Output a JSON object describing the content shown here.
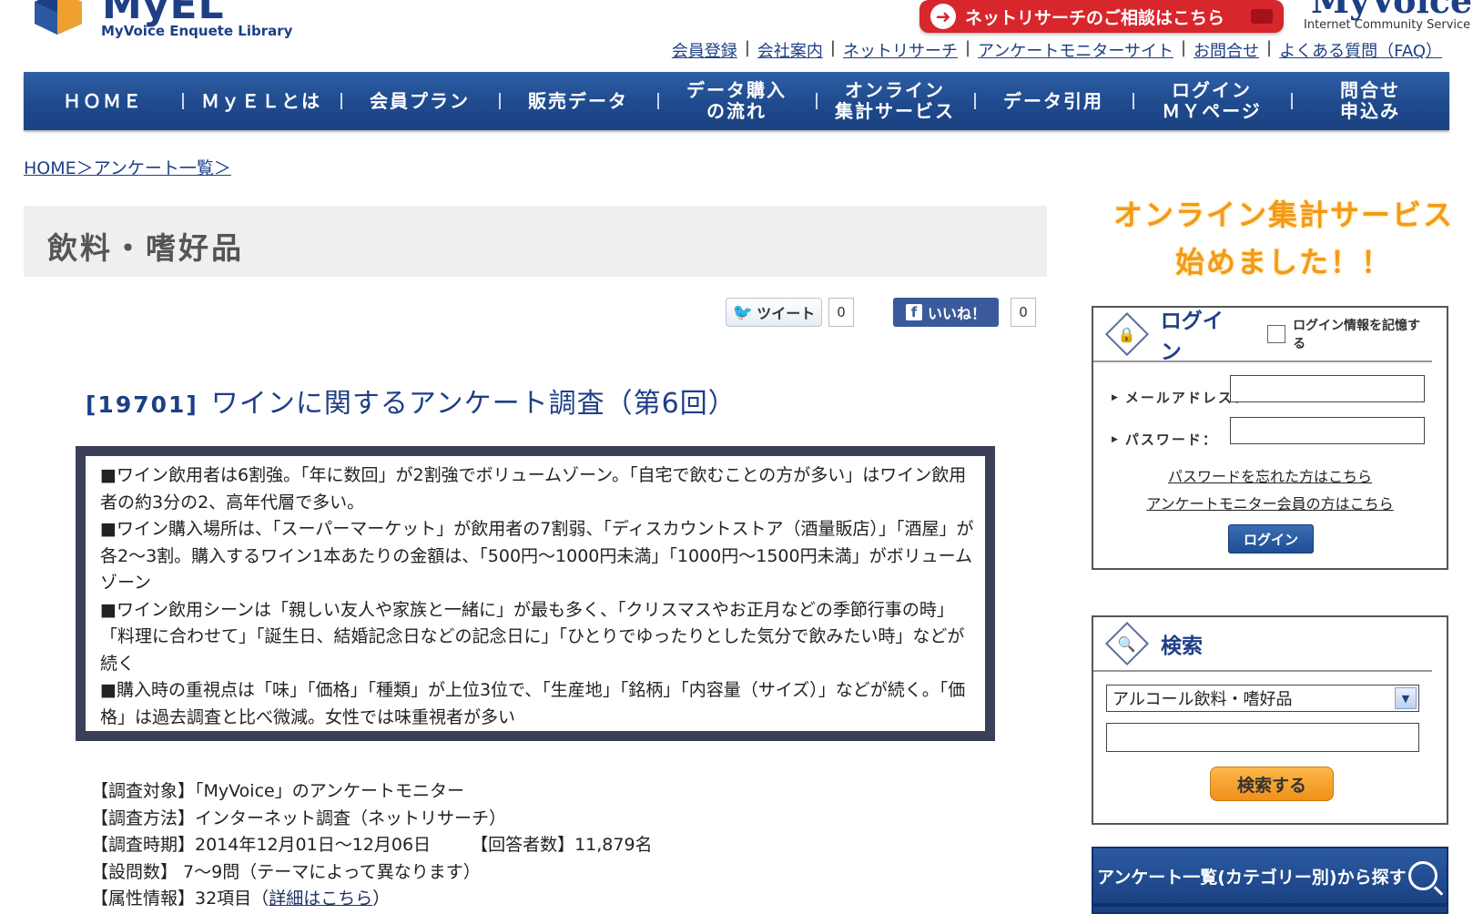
{
  "header": {
    "logo_text": "MyEL",
    "logo_sub": "MyVoice Enquete Library",
    "consult_label": "ネットリサーチのご相談はこちら",
    "brand_name": "MyVoice",
    "brand_sub": "Internet Community Service",
    "top_links": [
      "会員登録",
      "会社案内",
      "ネットリサーチ",
      "アンケートモニターサイト",
      "お問合せ",
      "よくある質問（FAQ）"
    ]
  },
  "nav": {
    "items": [
      "ＨＯＭＥ",
      "ＭｙＥＬとは",
      "会員プラン",
      "販売データ",
      "データ購入\nの流れ",
      "オンライン\n集計サービス",
      "データ引用",
      "ログイン\nＭＹページ",
      "問合せ\n申込み"
    ]
  },
  "breadcrumb": "HOME＞アンケート一覧＞",
  "category_title": "飲料・嗜好品",
  "social": {
    "tweet_label": "ツイート",
    "tweet_count": "0",
    "like_label": "いいね！",
    "like_count": "0"
  },
  "survey": {
    "number": "[19701]",
    "title": "ワインに関するアンケート調査（第6回）",
    "summary": [
      "■ワイン飲用者は6割強。「年に数回」が2割強でボリュームゾーン。「自宅で飲むことの方が多い」はワイン飲用者の約3分の2、高年代層で多い。",
      "■ワイン購入場所は、「スーパーマーケット」が飲用者の7割弱、「ディスカウントストア（酒量販店）」「酒屋」が各2～3割。購入するワイン1本あたりの金額は、「500円～1000円未満」「1000円～1500円未満」がボリュームゾーン",
      "■ワイン飲用シーンは「親しい友人や家族と一緒に」が最も多く、「クリスマスやお正月などの季節行事の時」「料理に合わせて」「誕生日、結婚記念日などの記念日に」「ひとりでゆったりとした気分で飲みたい時」などが続く",
      "■購入時の重視点は「味」「価格」「種類」が上位3位で、「生産地」「銘柄」「内容量（サイズ）」などが続く。「価格」は過去調査と比べ微減。女性では味重視者が多い"
    ],
    "target": "【調査対象】「MyVoice」のアンケートモニター",
    "method": "【調査方法】インターネット調査（ネットリサーチ）",
    "period": "【調査時期】2014年12月01日～12月06日",
    "respondents": "【回答者数】11,879名",
    "questions": "【設問数】 7～9問（テーマによって異なります）",
    "attributes_prefix": "【属性情報】32項目（",
    "attributes_link": "詳細はこちら",
    "attributes_suffix": "）"
  },
  "sidebar": {
    "promo_line1": "オンライン集計サービス",
    "promo_line2": "始めました！！",
    "login": {
      "title": "ログイン",
      "remember_label": "ログイン情報を記憶する",
      "email_label": "メールアドレス：",
      "password_label": "パスワード：",
      "forgot_link": "パスワードを忘れた方はこちら",
      "monitor_link": "アンケートモニター会員の方はこちら",
      "login_button": "ログイン"
    },
    "search": {
      "title": "検索",
      "selected_category": "アルコール飲料・嗜好品",
      "keyword_value": "",
      "search_button": "検索する"
    },
    "category_banner": "アンケート一覧(カテゴリー別)から探す"
  },
  "colors": {
    "brand_blue": "#1d3f86",
    "nav_blue": "#1f4a8d",
    "consult_red": "#d8262d",
    "promo_orange": "#f29a1a",
    "search_orange": "#f0901a"
  }
}
